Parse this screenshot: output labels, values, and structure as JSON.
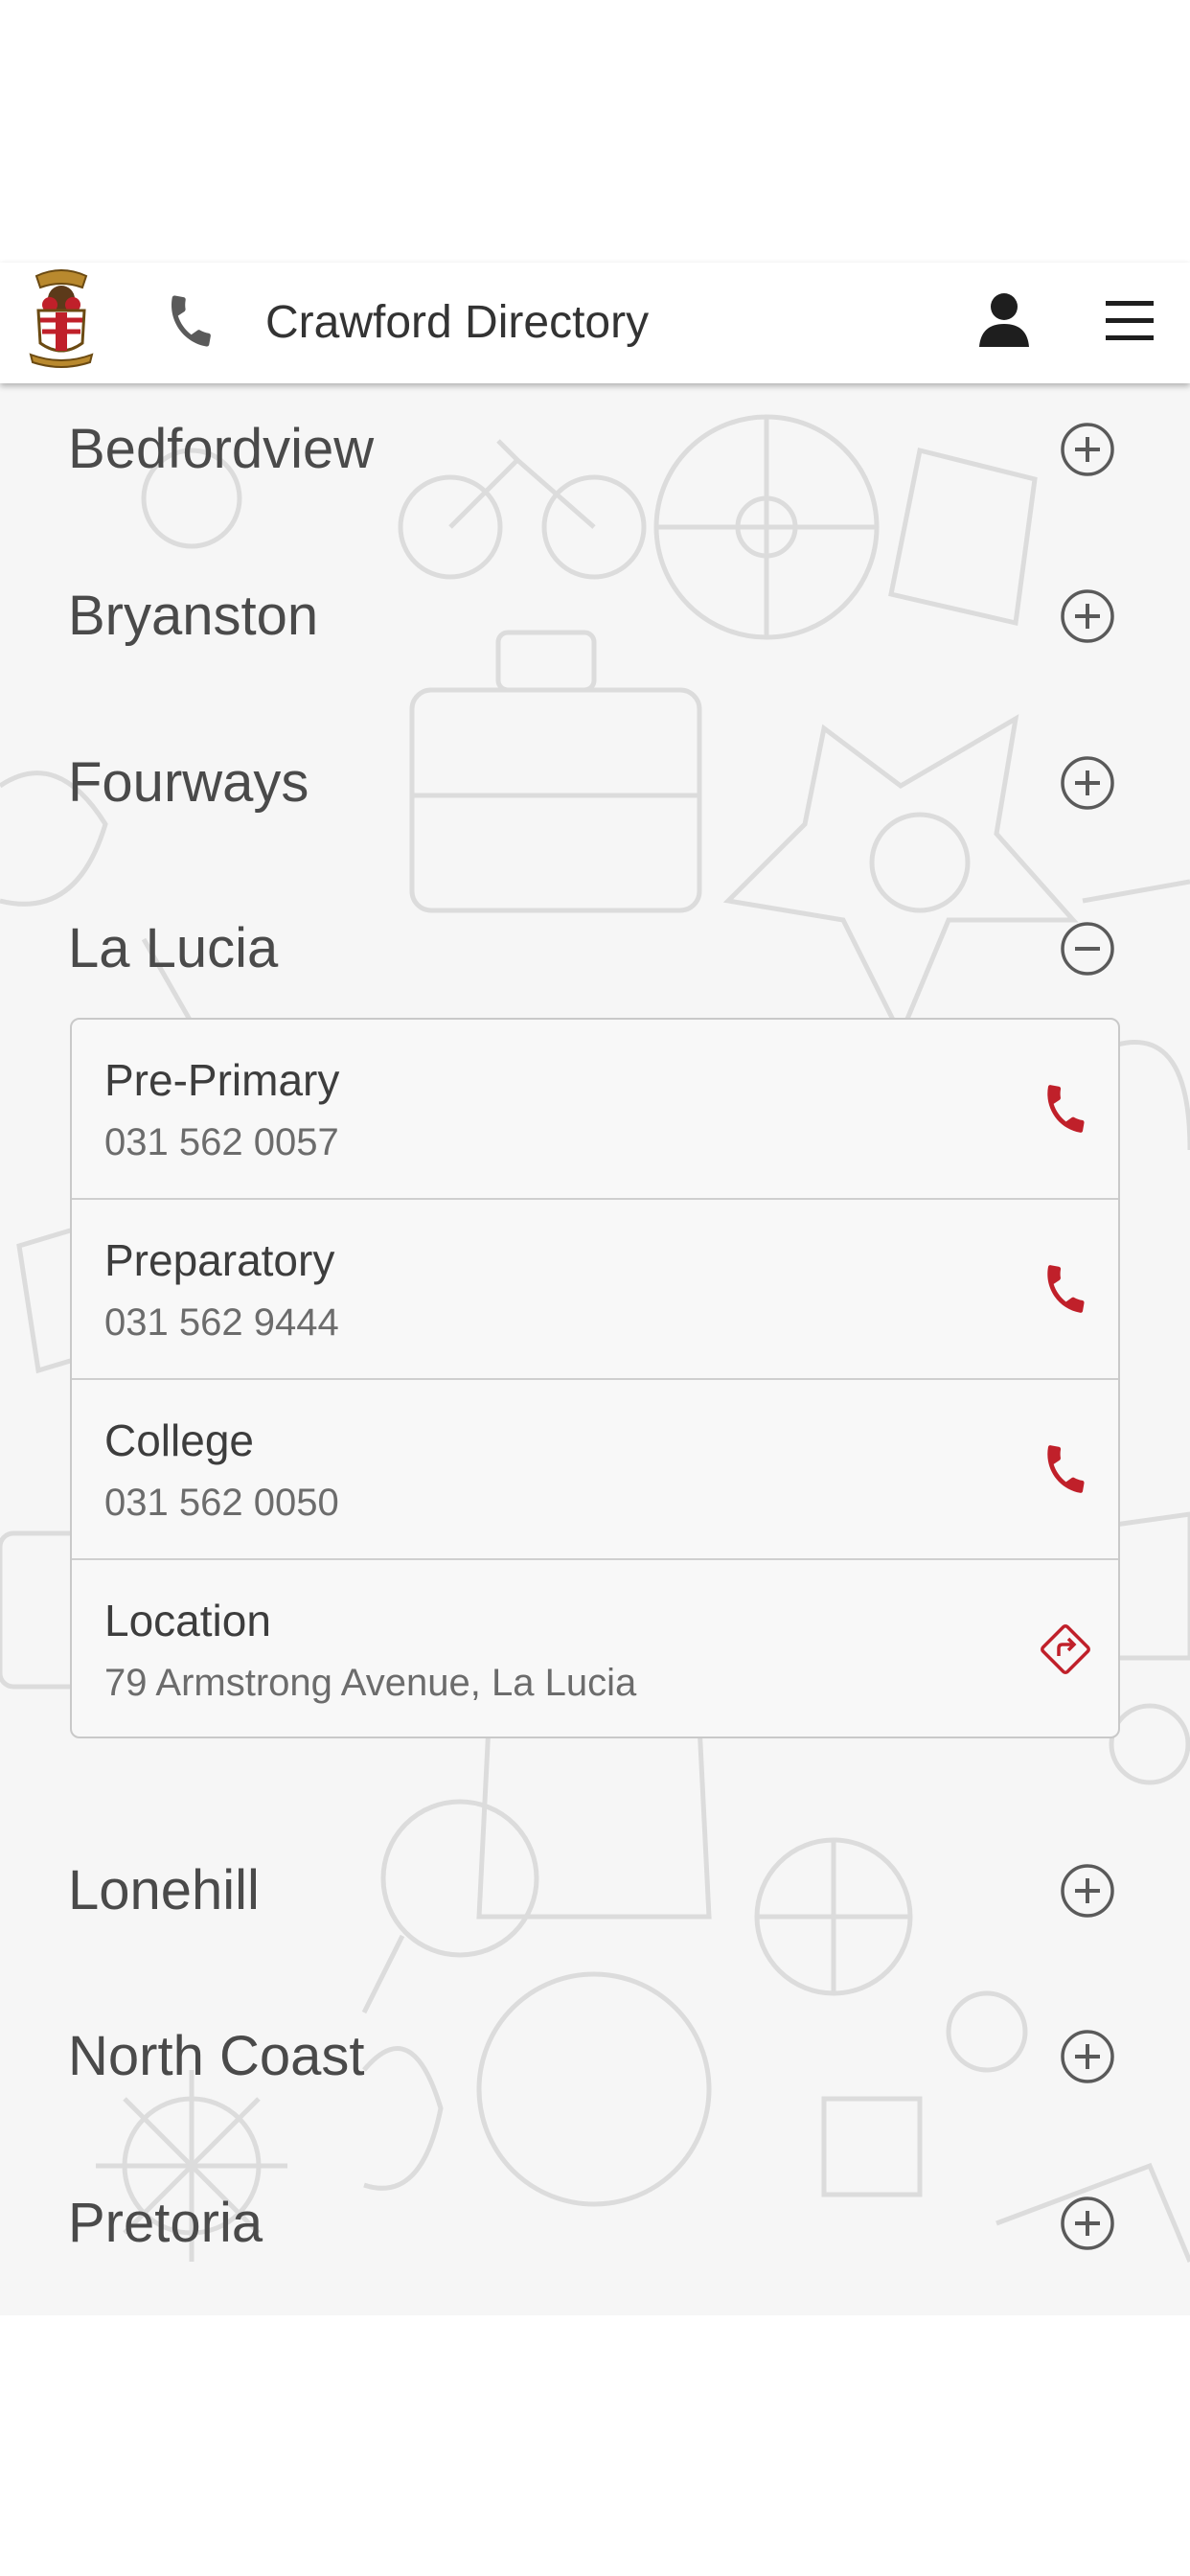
{
  "header": {
    "title": "Crawford Directory",
    "logo_icon": "crest-logo-icon",
    "phone_icon": "phone-icon",
    "user_icon": "user-icon",
    "menu_icon": "hamburger-menu-icon"
  },
  "regions": [
    {
      "name": "Bedfordview",
      "expanded": false
    },
    {
      "name": "Bryanston",
      "expanded": false
    },
    {
      "name": "Fourways",
      "expanded": false
    },
    {
      "name": "La Lucia",
      "expanded": true
    },
    {
      "name": "Lonehill",
      "expanded": false
    },
    {
      "name": "North Coast",
      "expanded": false
    },
    {
      "name": "Pretoria",
      "expanded": false
    }
  ],
  "expanded_region": {
    "entries": [
      {
        "label": "Pre-Primary",
        "value": "031 562 0057",
        "action_icon": "phone-icon"
      },
      {
        "label": "Preparatory",
        "value": "031 562 9444",
        "action_icon": "phone-icon"
      },
      {
        "label": "College",
        "value": "031 562 0050",
        "action_icon": "phone-icon"
      },
      {
        "label": "Location",
        "value": "79 Armstrong Avenue, La Lucia",
        "action_icon": "directions-icon"
      }
    ]
  },
  "colors": {
    "accent": "#c0202a",
    "text": "#4a4a4a",
    "background": "#f6f6f6",
    "header": "#ffffff"
  }
}
